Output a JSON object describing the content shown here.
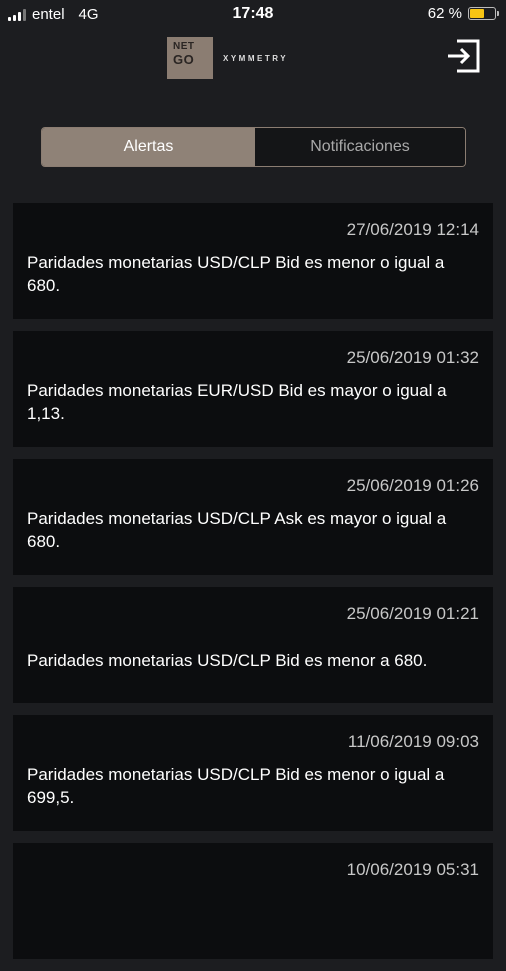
{
  "status_bar": {
    "carrier": "entel",
    "network": "4G",
    "time": "17:48",
    "battery_text": "62 %",
    "battery_level": 0.62
  },
  "header": {
    "logo_line1": "NET",
    "logo_line2": "GO",
    "logo_word": "XYMMETRY",
    "logout_icon": "logout-icon"
  },
  "tabs": {
    "alertas": "Alertas",
    "notificaciones": "Notificaciones",
    "active": "alertas"
  },
  "alerts": [
    {
      "date": "27/06/2019 12:14",
      "text": "Paridades monetarias USD/CLP Bid es menor o igual a 680."
    },
    {
      "date": "25/06/2019 01:32",
      "text": "Paridades monetarias EUR/USD Bid es mayor o igual a 1,13."
    },
    {
      "date": "25/06/2019 01:26",
      "text": "Paridades monetarias USD/CLP Ask es mayor o igual a 680."
    },
    {
      "date": "25/06/2019 01:21",
      "text": "Paridades monetarias USD/CLP Bid es menor a 680."
    },
    {
      "date": "11/06/2019 09:03",
      "text": "Paridades monetarias USD/CLP Bid es menor o igual a 699,5."
    },
    {
      "date": "10/06/2019 05:31",
      "text": ""
    }
  ],
  "colors": {
    "background": "#1c1d20",
    "card": "#0c0d0f",
    "accent": "#8f8277",
    "battery": "#f7c514"
  }
}
